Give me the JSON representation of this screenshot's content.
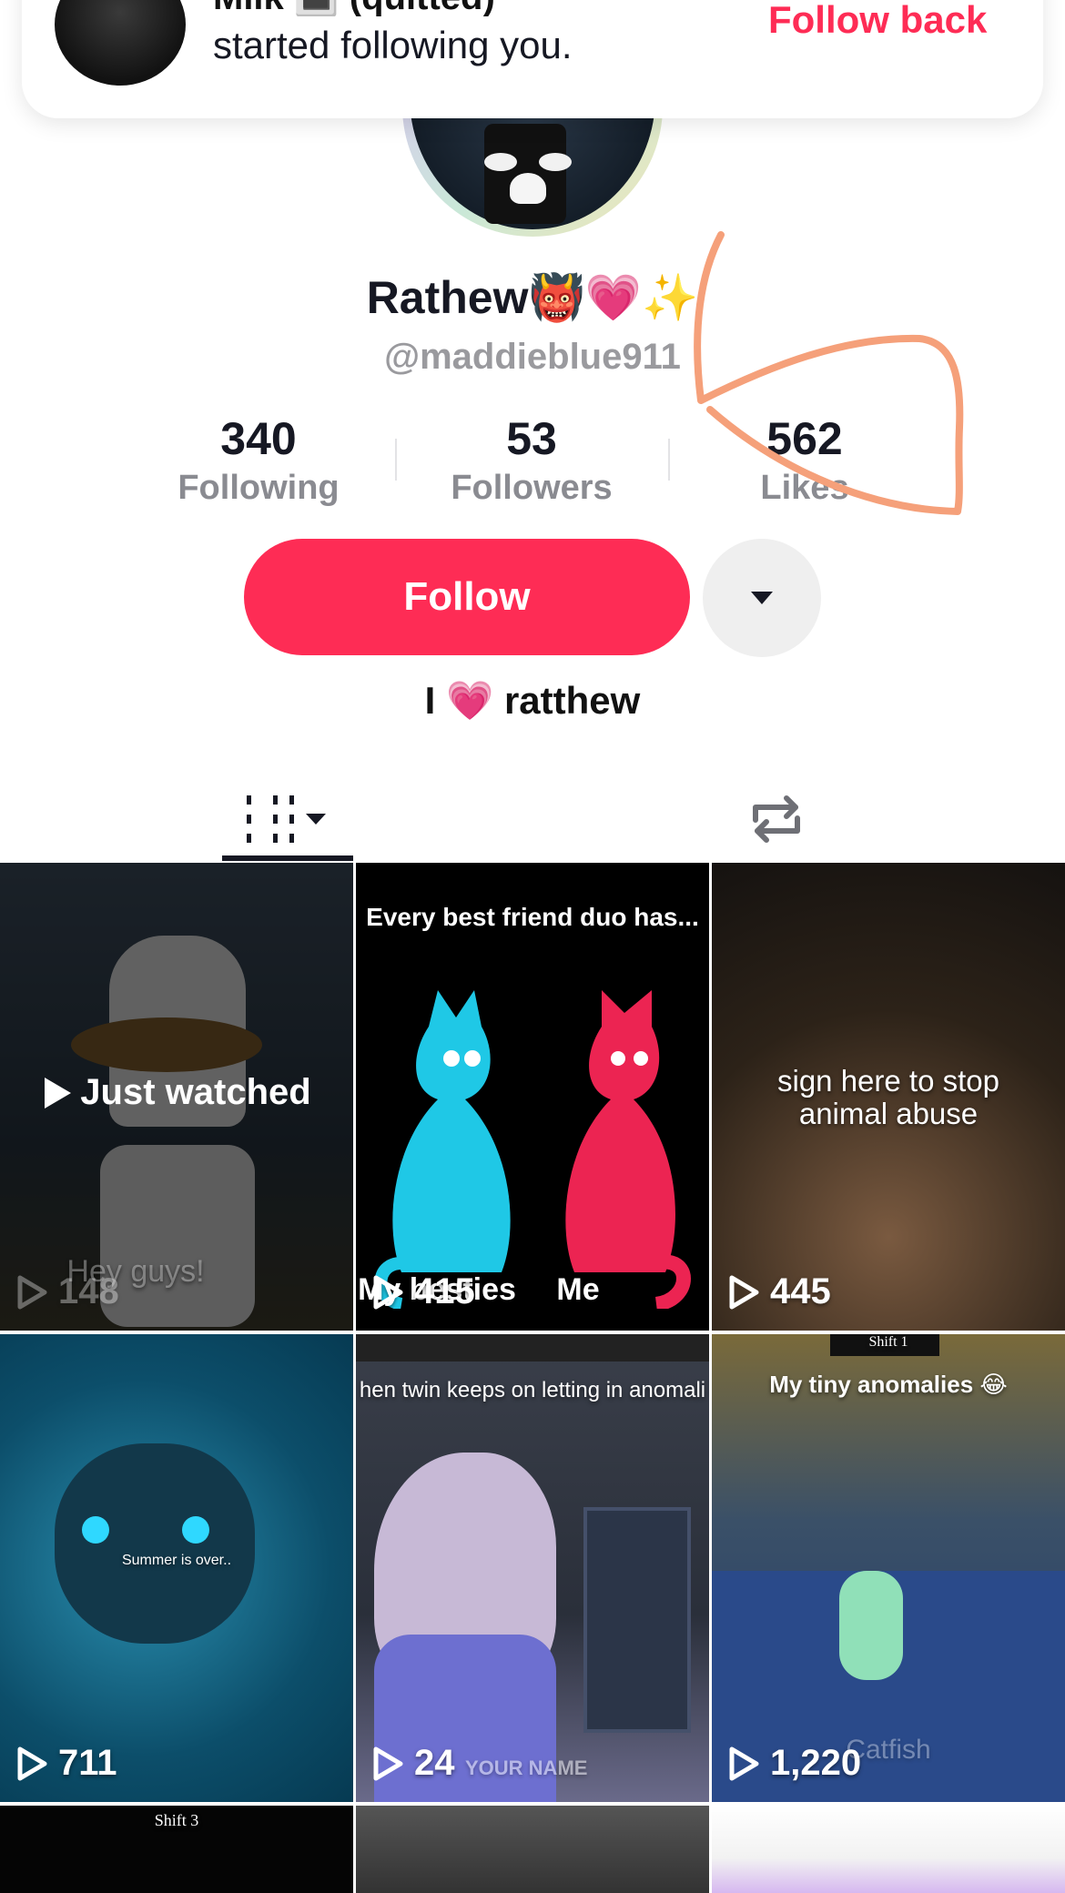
{
  "notification": {
    "title": "Milk 🔳 (quitted)",
    "text": "started following you.",
    "action": "Follow back"
  },
  "profile": {
    "display_name": "Rathew👹💗✨",
    "handle": "@maddieblue911",
    "bio": "I 💗 ratthew"
  },
  "stats": {
    "following": {
      "value": "340",
      "label": "Following"
    },
    "followers": {
      "value": "53",
      "label": "Followers"
    },
    "likes": {
      "value": "562",
      "label": "Likes"
    }
  },
  "actions": {
    "follow_label": "Follow"
  },
  "tabs": [
    {
      "name": "videos"
    },
    {
      "name": "reposts"
    }
  ],
  "videos": [
    {
      "caption": "Hey guys!",
      "views": "148",
      "status": "Just watched"
    },
    {
      "caption": "Every best friend duo has...",
      "caption2": "My besties",
      "caption3": "Me",
      "views": "415"
    },
    {
      "caption": "sign here to stop animal abuse",
      "views": "445"
    },
    {
      "caption": "Summer is over..",
      "views": "711"
    },
    {
      "caption": "hen twin keeps on letting in anomali",
      "watermark": "YOUR NAME",
      "views": "24"
    },
    {
      "caption": "My tiny anomalies 😂",
      "tag": "Shift 1",
      "watermark": "Catfish",
      "views": "1,220"
    },
    {
      "tag": "Shift 3"
    }
  ],
  "colors": {
    "accent": "#fe2c55",
    "annotation": "#f5a07a"
  }
}
